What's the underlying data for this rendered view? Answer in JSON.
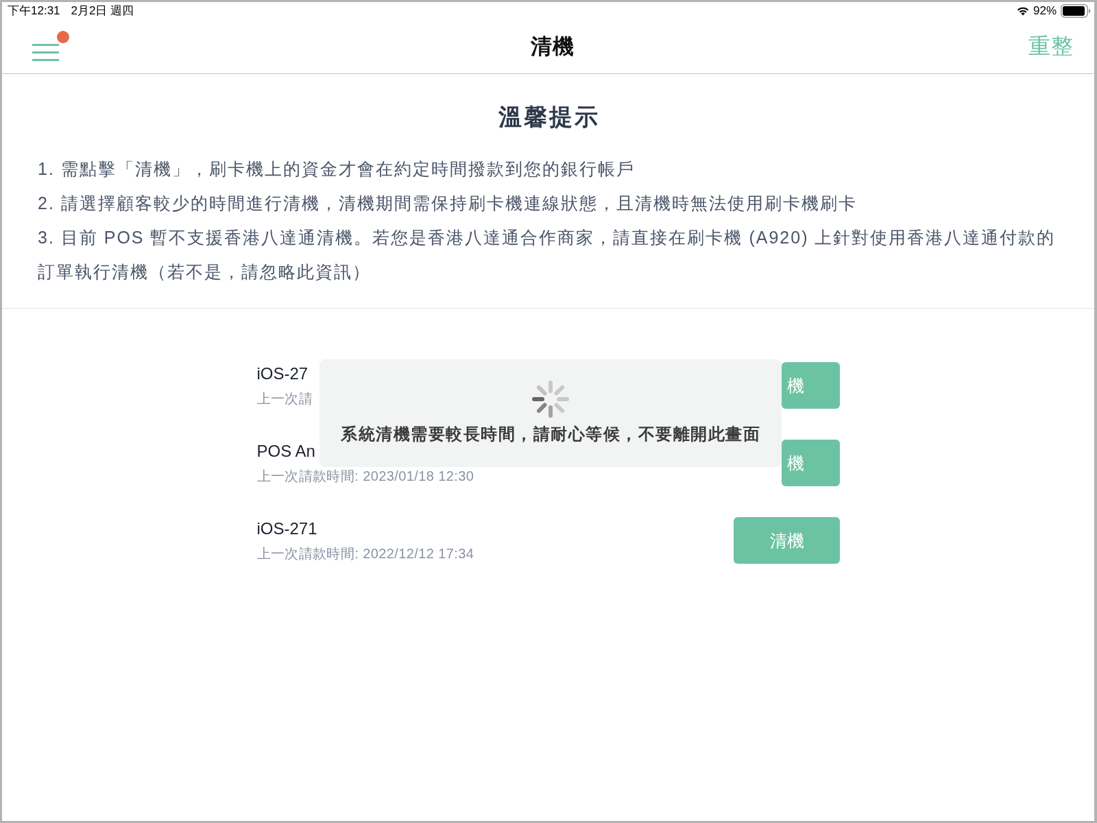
{
  "status_bar": {
    "time": "下午12:31",
    "date": "2月2日 週四",
    "battery": "92%"
  },
  "nav_bar": {
    "title": "清機",
    "menu_notification": true,
    "action": "重整"
  },
  "tips": {
    "title": "溫馨提示",
    "items": [
      "1. 需點擊「清機」，刷卡機上的資金才會在約定時間撥款到您的銀行帳戶",
      "2. 請選擇顧客較少的時間進行清機，清機期間需保持刷卡機連線狀態，且清機時無法使用刷卡機刷卡",
      "3. 目前 POS 暫不支援香港八達通清機。若您是香港八達通合作商家，請直接在刷卡機 (A920) 上針對使用香港八達通付款的訂單執行清機（若不是，請忽略此資訊）"
    ]
  },
  "terminals": [
    {
      "name": "iOS-27",
      "last_settlement": "上一次請",
      "button": "機"
    },
    {
      "name": "POS An",
      "last_settlement": "上一次請款時間: 2023/01/18 12:30",
      "button": "機"
    },
    {
      "name": "iOS-271",
      "last_settlement": "上一次請款時間: 2022/12/12 17:34",
      "button": "清機"
    }
  ],
  "loading_toast": {
    "message": "系統清機需要較長時間，請耐心等候，不要離開此畫面"
  }
}
